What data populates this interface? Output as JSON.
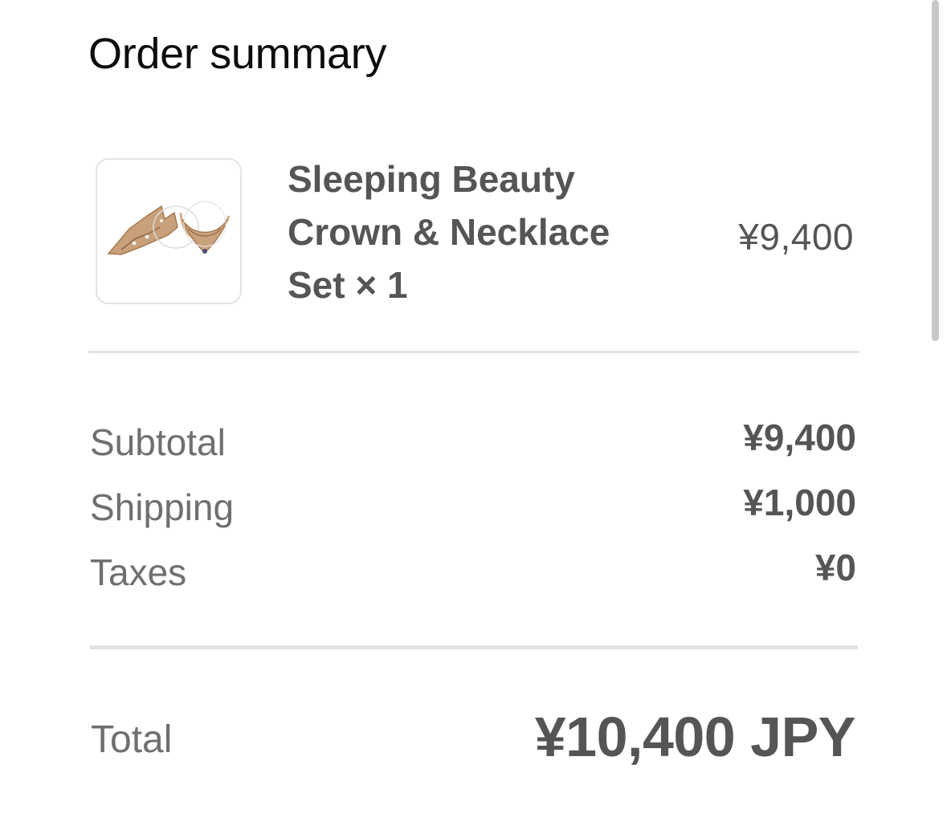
{
  "header": {
    "title": "Order summary"
  },
  "line_item": {
    "image_alt": "Sleeping Beauty Crown & Necklace Set",
    "name": "Sleeping Beauty Crown & Necklace",
    "name_last": "Set",
    "quantity": "× 1",
    "price": "¥9,400"
  },
  "summary": {
    "rows": [
      {
        "label": "Subtotal",
        "value": "¥9,400"
      },
      {
        "label": "Shipping",
        "value": "¥1,000"
      },
      {
        "label": "Taxes",
        "value": "¥0"
      }
    ]
  },
  "total": {
    "label": "Total",
    "value": "¥10,400 JPY"
  },
  "colors": {
    "text_primary": "#0d0d0d",
    "text_secondary": "#555555",
    "text_muted": "#6f6f6f",
    "divider": "#e4e4e4",
    "jewelry_gold": "#c49a6c"
  }
}
